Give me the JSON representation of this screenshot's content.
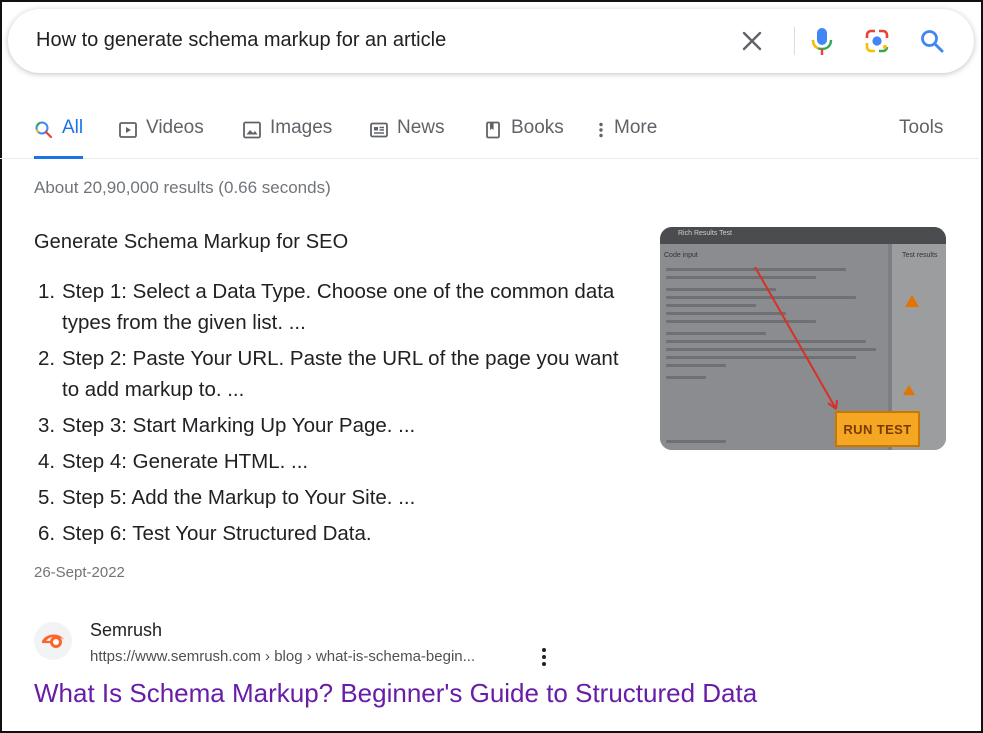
{
  "search": {
    "query": "How to generate schema markup for an article",
    "clear_icon": "close-icon",
    "voice_icon": "mic-icon",
    "lens_icon": "camera-lens-icon",
    "search_icon": "search-icon"
  },
  "tabs": {
    "items": [
      {
        "label": "All",
        "icon": "search-icon",
        "active": true
      },
      {
        "label": "Videos",
        "icon": "play-icon"
      },
      {
        "label": "Images",
        "icon": "image-icon"
      },
      {
        "label": "News",
        "icon": "news-icon"
      },
      {
        "label": "Books",
        "icon": "book-icon"
      },
      {
        "label": "More",
        "icon": "more-vert-icon"
      }
    ],
    "tools": "Tools"
  },
  "stats": "About 20,90,000 results (0.66 seconds)",
  "snippet": {
    "title": "Generate Schema Markup for SEO",
    "steps": [
      {
        "num": "1.",
        "text": "Step 1: Select a Data Type. Choose one of the common data types from the given list. ..."
      },
      {
        "num": "2.",
        "text": "Step 2: Paste Your URL. Paste the URL of the page you want to add markup to. ..."
      },
      {
        "num": "3.",
        "text": "Step 3: Start Marking Up Your Page. ..."
      },
      {
        "num": "4.",
        "text": "Step 4: Generate HTML. ..."
      },
      {
        "num": "5.",
        "text": "Step 5: Add the Markup to Your Site. ..."
      },
      {
        "num": "6.",
        "text": "Step 6: Test Your Structured Data."
      }
    ],
    "date": "26-Sept-2022",
    "thumbnail": {
      "bar_text": "Rich Results Test",
      "left_label": "Code input",
      "right_label": "Test results",
      "button": "RUN TEST"
    }
  },
  "result": {
    "site": "Semrush",
    "url": "https://www.semrush.com › blog › what-is-schema-begin...",
    "title": "What Is Schema Markup? Beginner's Guide to Structured Data",
    "favicon": "semrush-logo-icon"
  },
  "colors": {
    "accent": "#1a73e8",
    "visited_link": "#681da8",
    "muted": "#70757a",
    "run_test": "#f5a623"
  }
}
